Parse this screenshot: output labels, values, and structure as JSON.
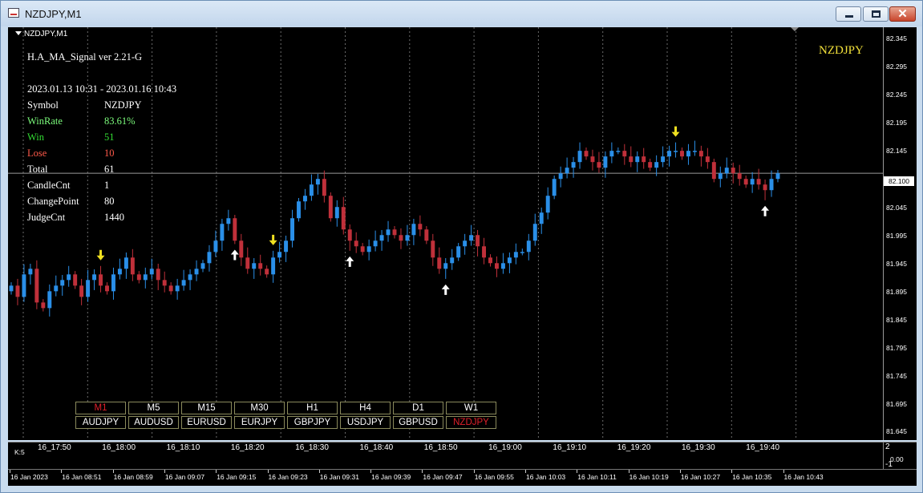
{
  "window": {
    "title": "NZDJPY,M1",
    "close_glyph": "✕"
  },
  "chart": {
    "symbol_timeframe": "NZDJPY,M1",
    "symbol_big": "NZDJPY",
    "current_price": "82.100",
    "price_labels": [
      "82.345",
      "82.295",
      "82.245",
      "82.195",
      "82.145",
      "82.045",
      "81.995",
      "81.945",
      "81.895",
      "81.845",
      "81.795",
      "81.745",
      "81.695",
      "81.645"
    ],
    "period_labels": [
      "16_17:50",
      "16_18:00",
      "16_18:10",
      "16_18:20",
      "16_18:30",
      "16_18:40",
      "16_18:50",
      "16_19:00",
      "16_19:10",
      "16_19:20",
      "16_19:30",
      "16_19:40"
    ]
  },
  "panel": {
    "title": "H.A_MA_Signal ver 2.21-G",
    "date_range": "2023.01.13 10:31 - 2023.01.16 10:43",
    "rows": [
      {
        "label": "Symbol",
        "value": "NZDJPY",
        "color": "#ffffff"
      },
      {
        "label": "WinRate",
        "value": "83.61%",
        "color": "#7cfc7c"
      },
      {
        "label": "Win",
        "value": "51",
        "color": "#33dd33"
      },
      {
        "label": "Lose",
        "value": "10",
        "color": "#ff5a4a"
      },
      {
        "label": "Total",
        "value": "61",
        "color": "#ffffff"
      },
      {
        "label": "CandleCnt",
        "value": "1",
        "color": "#ffffff"
      },
      {
        "label": "ChangePoint",
        "value": "80",
        "color": "#ffffff"
      },
      {
        "label": "JudgeCnt",
        "value": "1440",
        "color": "#ffffff"
      }
    ]
  },
  "timeframes": [
    "M1",
    "M5",
    "M15",
    "M30",
    "H1",
    "H4",
    "D1",
    "W1"
  ],
  "active_timeframe": "M1",
  "symbols": [
    "AUDJPY",
    "AUDUSD",
    "EURUSD",
    "EURJPY",
    "GBPJPY",
    "USDJPY",
    "GBPUSD",
    "NZDJPY"
  ],
  "active_symbol": "NZDJPY",
  "indicator": {
    "label": "K:5",
    "scale_top": "2",
    "scale_mid": "0.00",
    "scale_bot": "-1"
  },
  "time_axis": [
    "16 Jan 2023",
    "16 Jan 08:51",
    "16 Jan 08:59",
    "16 Jan 09:07",
    "16 Jan 09:15",
    "16 Jan 09:23",
    "16 Jan 09:31",
    "16 Jan 09:39",
    "16 Jan 09:47",
    "16 Jan 09:55",
    "16 Jan 10:03",
    "16 Jan 10:11",
    "16 Jan 10:19",
    "16 Jan 10:27",
    "16 Jan 10:35",
    "16 Jan 10:43"
  ],
  "colors": {
    "bull": "#2a8fe8",
    "bear": "#c0303a",
    "grid": "#6b6b6b",
    "buy_arrow": "#ffffff",
    "sell_arrow": "#f0e020",
    "active": "#e0202a"
  },
  "chart_data": {
    "type": "candlestick",
    "ylim": [
      81.625,
      82.36
    ],
    "closes": [
      81.9,
      81.88,
      81.92,
      81.93,
      81.87,
      81.86,
      81.89,
      81.9,
      81.91,
      81.92,
      81.9,
      81.88,
      81.91,
      81.92,
      81.9,
      81.89,
      81.92,
      81.93,
      81.95,
      81.92,
      81.91,
      81.92,
      81.93,
      81.91,
      81.9,
      81.89,
      81.9,
      81.91,
      81.92,
      81.93,
      81.94,
      81.96,
      81.98,
      82.01,
      82.02,
      81.98,
      81.95,
      81.93,
      81.94,
      81.93,
      81.92,
      81.95,
      81.96,
      81.98,
      82.02,
      82.05,
      82.06,
      82.08,
      82.09,
      82.06,
      82.02,
      82.04,
      82.0,
      81.98,
      81.97,
      81.96,
      81.97,
      81.98,
      81.99,
      82.0,
      81.99,
      81.98,
      81.99,
      82.01,
      82.0,
      81.98,
      81.95,
      81.93,
      81.94,
      81.95,
      81.97,
      81.98,
      81.99,
      81.97,
      81.95,
      81.94,
      81.93,
      81.94,
      81.95,
      81.96,
      81.96,
      81.98,
      82.01,
      82.03,
      82.06,
      82.09,
      82.1,
      82.11,
      82.12,
      82.14,
      82.13,
      82.12,
      82.11,
      82.13,
      82.14,
      82.14,
      82.13,
      82.12,
      82.13,
      82.12,
      82.11,
      82.12,
      82.13,
      82.14,
      82.14,
      82.13,
      82.14,
      82.14,
      82.13,
      82.12,
      82.09,
      82.1,
      82.11,
      82.1,
      82.09,
      82.08,
      82.09,
      82.08,
      82.07,
      82.09,
      82.1
    ],
    "sell_signals": [
      14,
      41,
      104
    ],
    "buy_signals": [
      35,
      53,
      68,
      118
    ]
  }
}
